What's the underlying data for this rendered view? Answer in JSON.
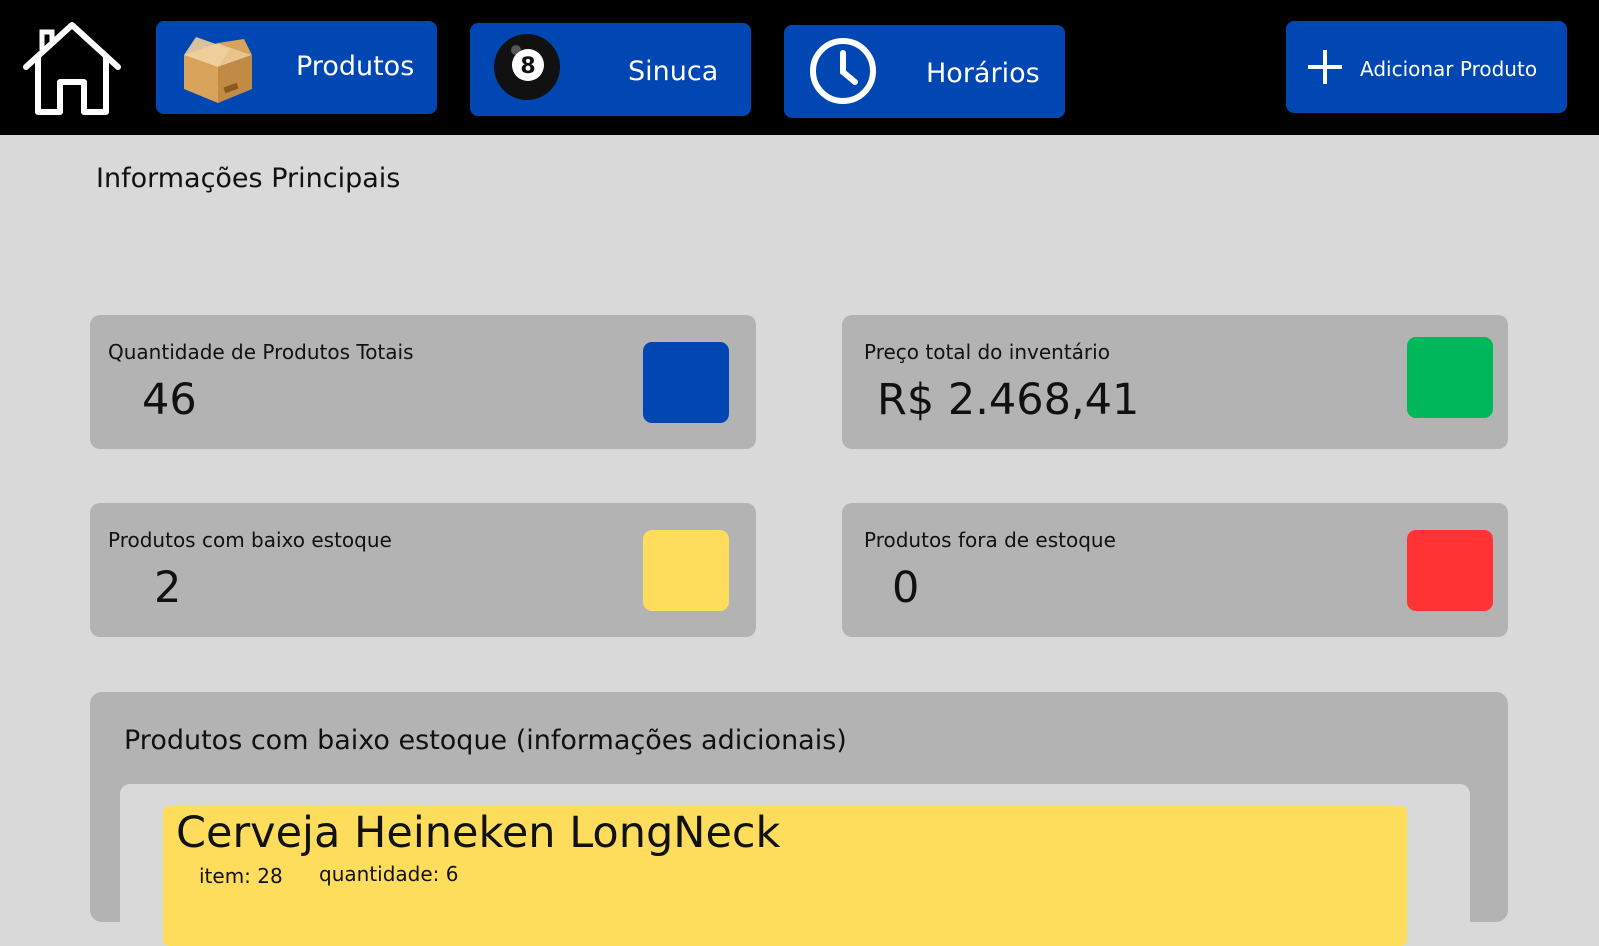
{
  "nav": {
    "home_icon": "home-icon",
    "produtos": {
      "label": "Produtos",
      "icon": "box-icon"
    },
    "sinuca": {
      "label": "Sinuca",
      "icon": "eight-ball-icon"
    },
    "horarios": {
      "label": "Horários",
      "icon": "clock-icon"
    },
    "adicionar": {
      "label": "Adicionar Produto",
      "icon": "plus-icon"
    },
    "colors": {
      "bar": "#000000",
      "button": "#0047b3",
      "text": "#ffffff"
    }
  },
  "main": {
    "title": "Informações Principais",
    "cards": [
      {
        "title": "Quantidade de Produtos Totais",
        "value": "46",
        "color": "#0047b3"
      },
      {
        "title": "Preço total do inventário",
        "value": "R$ 2.468,41",
        "color": "#00b85c"
      },
      {
        "title": "Produtos com baixo estoque",
        "value": "2",
        "color": "#ffdd5c"
      },
      {
        "title": "Produtos fora de estoque",
        "value": "0",
        "color": "#ff3333"
      }
    ]
  },
  "low_stock": {
    "title": "Produtos com baixo estoque (informações adicionais)",
    "items": [
      {
        "name": "Cerveja Heineken LongNeck",
        "item": "item: 28",
        "quantidade": "quantidade: 6"
      }
    ]
  }
}
